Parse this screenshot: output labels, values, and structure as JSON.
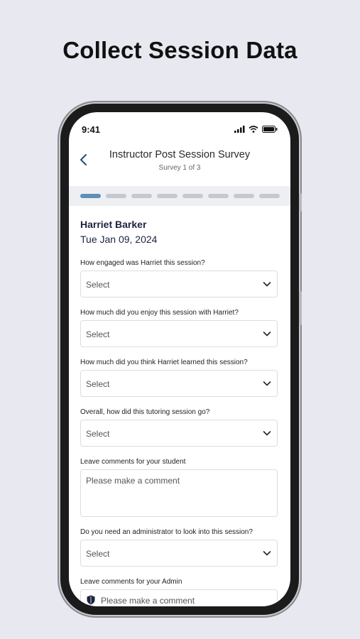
{
  "headline": "Collect Session Data",
  "status_bar": {
    "time": "9:41",
    "icons": [
      "signal-icon",
      "wifi-icon",
      "battery-icon"
    ]
  },
  "nav": {
    "title": "Instructor Post Session Survey",
    "subtitle": "Survey 1 of 3",
    "back_icon": "chevron-left-icon"
  },
  "progress": {
    "total_steps": 8,
    "current_step": 1,
    "active_color": "#5d8fb8",
    "inactive_color": "#c5c8d0"
  },
  "student": {
    "name": "Harriet Barker",
    "date": "Tue Jan 09, 2024"
  },
  "questions": [
    {
      "label": "How engaged was Harriet this session?",
      "value": "Select"
    },
    {
      "label": "How much did you enjoy this session with Harriet?",
      "value": "Select"
    },
    {
      "label": "How much did you think Harriet learned this session?",
      "value": "Select"
    },
    {
      "label": "Overall, how did this tutoring session go?",
      "value": "Select"
    }
  ],
  "student_comment": {
    "label": "Leave comments for your student",
    "placeholder": "Please make a comment"
  },
  "admin_question": {
    "label": "Do you need an administrator to look into this session?",
    "value": "Select"
  },
  "admin_comment": {
    "label": "Leave comments for your Admin",
    "placeholder": "Please make a comment",
    "icon": "shield-icon"
  }
}
